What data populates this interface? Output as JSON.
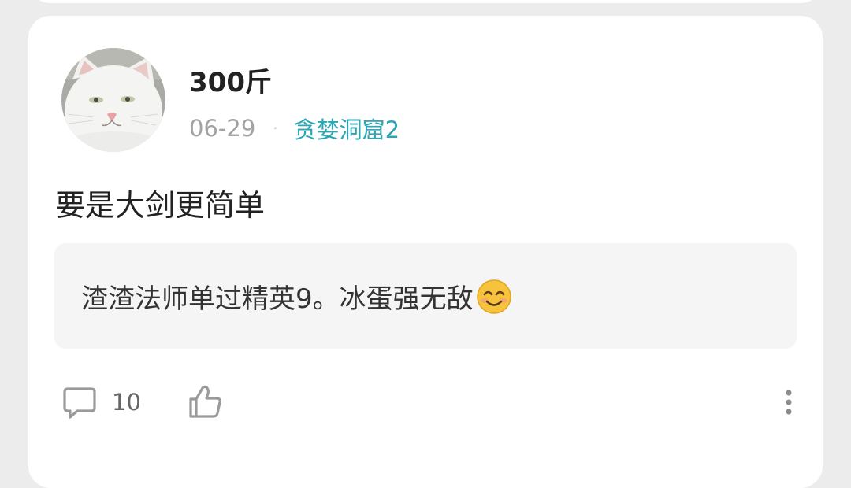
{
  "post": {
    "author": {
      "name": "300斤",
      "avatar_icon": "white-cat-avatar"
    },
    "date": "06-29",
    "separator": "·",
    "group": "贪婪洞窟2",
    "title": "要是大剑更简单",
    "quote": {
      "text": "渣渣法师单过精英9。冰蛋强无敌",
      "emoji_icon": "smiling-face-emoji"
    },
    "actions": {
      "comment_icon": "comment-icon",
      "comment_count": "10",
      "like_icon": "thumbs-up-icon",
      "more_icon": "more-vertical-icon"
    }
  },
  "colors": {
    "accent": "#2aa6b4",
    "background": "#ececec",
    "card": "#ffffff",
    "quote_bg": "#f5f5f5"
  }
}
